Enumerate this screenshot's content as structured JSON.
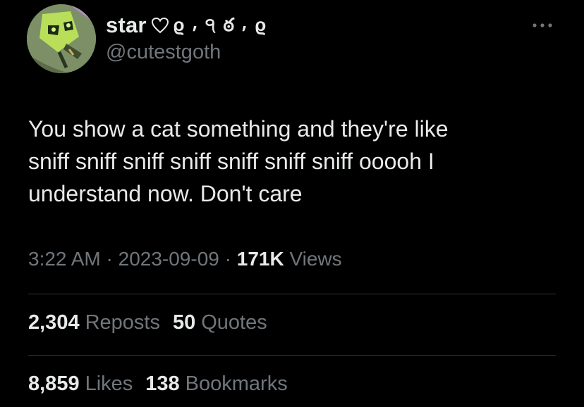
{
  "tweet": {
    "author": {
      "display_name": "star",
      "name_decoration": "ϱ ⸴ ੧ ఠ ⸴ ϱ",
      "handle": "@cutestgoth",
      "avatar_icon": "gir-avatar-icon",
      "heart_icon": "heart-outline-icon"
    },
    "more_icon": "more-dots-icon",
    "text": "You show a cat something and they're like\nsniff sniff sniff sniff sniff sniff sniff ooooh I\nunderstand now. Don't care",
    "meta": {
      "time": "3:22 AM",
      "sep1": " · ",
      "date": "2023-09-09",
      "sep2": " · ",
      "views_count": "171K",
      "views_label": " Views"
    },
    "stats": {
      "reposts_count": "2,304",
      "reposts_label": "Reposts",
      "quotes_count": "50",
      "quotes_label": "Quotes",
      "likes_count": "8,859",
      "likes_label": "Likes",
      "bookmarks_count": "138",
      "bookmarks_label": "Bookmarks"
    }
  },
  "colors": {
    "background": "#000000",
    "primary_text": "#e7e9ea",
    "secondary_text": "#71767b",
    "divider": "#2f3336"
  }
}
